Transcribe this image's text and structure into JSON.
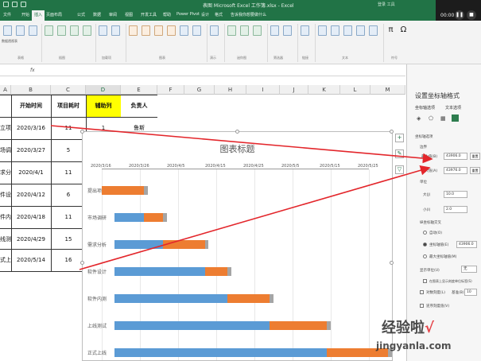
{
  "window": {
    "title": "表图 Microsoft Excel 工作簿.xlsx - Excel",
    "sign_in": "登录 工具"
  },
  "tabs": [
    "文件",
    "开始",
    "插入",
    "页面布局",
    "公式",
    "数据",
    "审阅",
    "视图",
    "开发工具",
    "帮助",
    "Power Pivot",
    "设计",
    "格式"
  ],
  "tell_me": "告诉我你想要做什么",
  "video": {
    "time": "00:00"
  },
  "ribbon": {
    "buttons": [
      "数据透视表",
      "推荐的数据透视表",
      "表格",
      "图片",
      "形状",
      "图标",
      "3D模型",
      "SmartArt",
      "屏幕截图",
      "获取加载项",
      "我的加载项",
      "推荐的图表",
      "地图",
      "数据透视图",
      "三维地图",
      "折线",
      "柱形",
      "盈亏",
      "切片器",
      "日程表",
      "链接",
      "文本框",
      "页眉和页脚",
      "艺术字",
      "签名行",
      "对象",
      "公式",
      "符号"
    ],
    "groups": [
      "表格",
      "插图",
      "加载项",
      "图表",
      "演示",
      "迷你图",
      "筛选器",
      "链接",
      "文本",
      "符号"
    ]
  },
  "columns": [
    "A",
    "B",
    "C",
    "D",
    "E",
    "F",
    "G",
    "H",
    "I",
    "J",
    "K",
    "L",
    "M"
  ],
  "table": {
    "headers": {
      "b": "开始时间",
      "c": "项目耗时",
      "d": "辅助列",
      "e": "负责人"
    },
    "rows": [
      {
        "a": "立项目",
        "b": "2020/3/16",
        "c": "11",
        "d": "1",
        "e": "鲁斯"
      },
      {
        "a": "场调研",
        "b": "2020/3/27",
        "c": "5"
      },
      {
        "a": "求分析",
        "b": "2020/4/1",
        "c": "11"
      },
      {
        "a": "件设计",
        "b": "2020/4/12",
        "c": "6"
      },
      {
        "a": "件内测",
        "b": "2020/4/18",
        "c": "11"
      },
      {
        "a": "线测试",
        "b": "2020/4/29",
        "c": "15"
      },
      {
        "a": "式上线",
        "b": "2020/5/14",
        "c": "16"
      }
    ]
  },
  "chart": {
    "title": "图表标题",
    "axis_ticks": [
      "2020/3/16",
      "2020/3/26",
      "2020/4/5",
      "2020/4/15",
      "2020/4/25",
      "2020/5/5",
      "2020/5/15",
      "2020/5/25"
    ],
    "side_buttons": [
      "+",
      "✎",
      "▽"
    ]
  },
  "chart_data": {
    "type": "bar",
    "orientation": "horizontal",
    "stacked": true,
    "title": "图表标题",
    "categories": [
      "提出项目",
      "市场调研",
      "需求分析",
      "软件设计",
      "软件内测",
      "上线测试",
      "正式上线"
    ],
    "series": [
      {
        "name": "开始时间",
        "values": [
          "2020/3/16",
          "2020/3/27",
          "2020/4/1",
          "2020/4/12",
          "2020/4/18",
          "2020/4/29",
          "2020/5/14"
        ]
      },
      {
        "name": "项目耗时",
        "values": [
          11,
          5,
          11,
          6,
          11,
          15,
          16
        ]
      },
      {
        "name": "辅助列",
        "values": [
          1,
          1,
          1,
          1,
          1,
          1,
          1
        ]
      }
    ],
    "x_axis_range": [
      "2020/3/16",
      "2020/5/25"
    ],
    "x_axis_position": "top",
    "colors": [
      "#5b9bd5",
      "#ed7d31",
      "#a5a5a5"
    ],
    "grid": true
  },
  "pane": {
    "title": "设置坐标轴格式",
    "tab_axis": "坐标轴选项",
    "tab_text": "文本选项",
    "section": "坐标轴选项",
    "bounds": "边界",
    "min_label": "最小值(B)",
    "min_value": "43906.0",
    "max_label": "最大值(A)",
    "max_value": "43976.0",
    "reset": "重置",
    "units": "单位",
    "major_label": "大(J)",
    "major_value": "10.0",
    "minor_label": "小(I)",
    "minor_value": "2.0",
    "cross_label": "纵坐标轴交叉",
    "opt_auto": "自动(O)",
    "opt_value": "坐标轴值(E)",
    "opt_value_input": "43906.0",
    "opt_max": "最大坐标轴值(M)",
    "display_units": "显示单位(U)",
    "display_units_value": "无",
    "show_units_label": "在图表上显示刻度单位标签(S)",
    "log_scale": "对数刻度(L)",
    "log_base": "基准(B)",
    "log_base_value": "10",
    "reverse": "逆序刻度值(V)"
  },
  "watermark": {
    "name": "经验啦",
    "check": "√",
    "url": "jingyanla.com"
  },
  "colors": {
    "excel_green": "#217346",
    "arrow_red": "#e3262b",
    "bar_blue": "#5b9bd5",
    "bar_orange": "#ed7d31",
    "bar_gray": "#a5a5a5"
  }
}
